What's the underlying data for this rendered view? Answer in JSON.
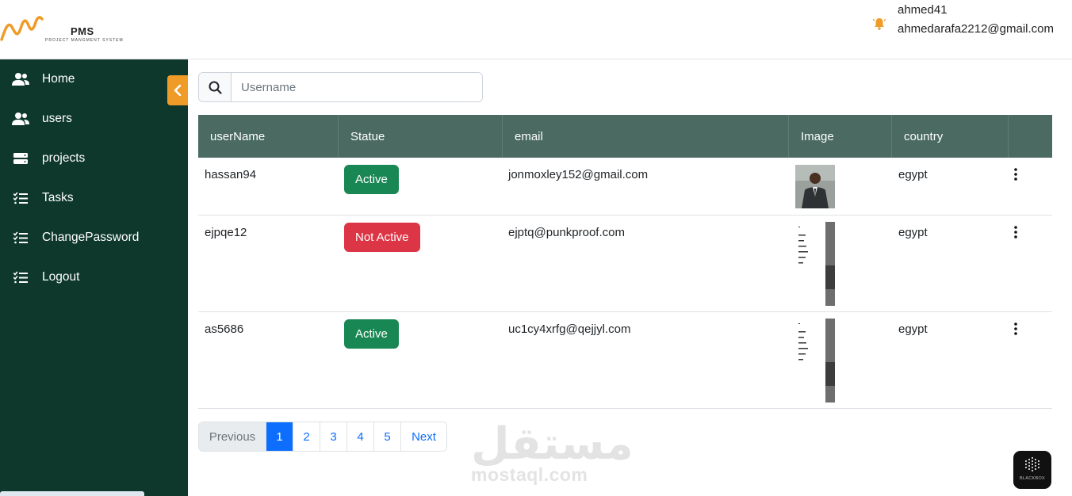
{
  "header": {
    "app_name": "PMS",
    "app_subtitle": "PROJECT MANGMENT SYSTEM",
    "user_name": "ahmed41",
    "user_email": "ahmedarafa2212@gmail.com"
  },
  "sidebar": {
    "items": [
      {
        "label": "Home",
        "icon": "users-icon"
      },
      {
        "label": "users",
        "icon": "users-icon"
      },
      {
        "label": "projects",
        "icon": "server-icon"
      },
      {
        "label": "Tasks",
        "icon": "list-check-icon"
      },
      {
        "label": "ChangePassword",
        "icon": "list-check-icon"
      },
      {
        "label": "Logout",
        "icon": "list-check-icon"
      }
    ]
  },
  "search": {
    "placeholder": "Username",
    "value": ""
  },
  "table": {
    "columns": [
      "userName",
      "Statue",
      "email",
      "Image",
      "country",
      ""
    ],
    "rows": [
      {
        "username": "hassan94",
        "status": "Active",
        "email": "jonmoxley152@gmail.com",
        "country": "egypt"
      },
      {
        "username": "ejpqe12",
        "status": "Not Active",
        "email": "ejptq@punkproof.com",
        "country": "egypt"
      },
      {
        "username": "as5686",
        "status": "Active",
        "email": "uc1cy4xrfg@qejjyl.com",
        "country": "egypt"
      }
    ]
  },
  "pagination": {
    "previous": "Previous",
    "pages": [
      "1",
      "2",
      "3",
      "4",
      "5"
    ],
    "current": "1",
    "next": "Next"
  },
  "watermark": {
    "arabic": "مستقل",
    "latin": "mostaql.com"
  },
  "badge_app": {
    "label": "BLACKBOX"
  },
  "colors": {
    "sidebar_bg": "#0e382c",
    "table_header_bg": "#4b6b62",
    "accent_orange": "#ef9b28",
    "active_green": "#198754",
    "inactive_red": "#dc3545",
    "pager_blue": "#0d6efd"
  }
}
